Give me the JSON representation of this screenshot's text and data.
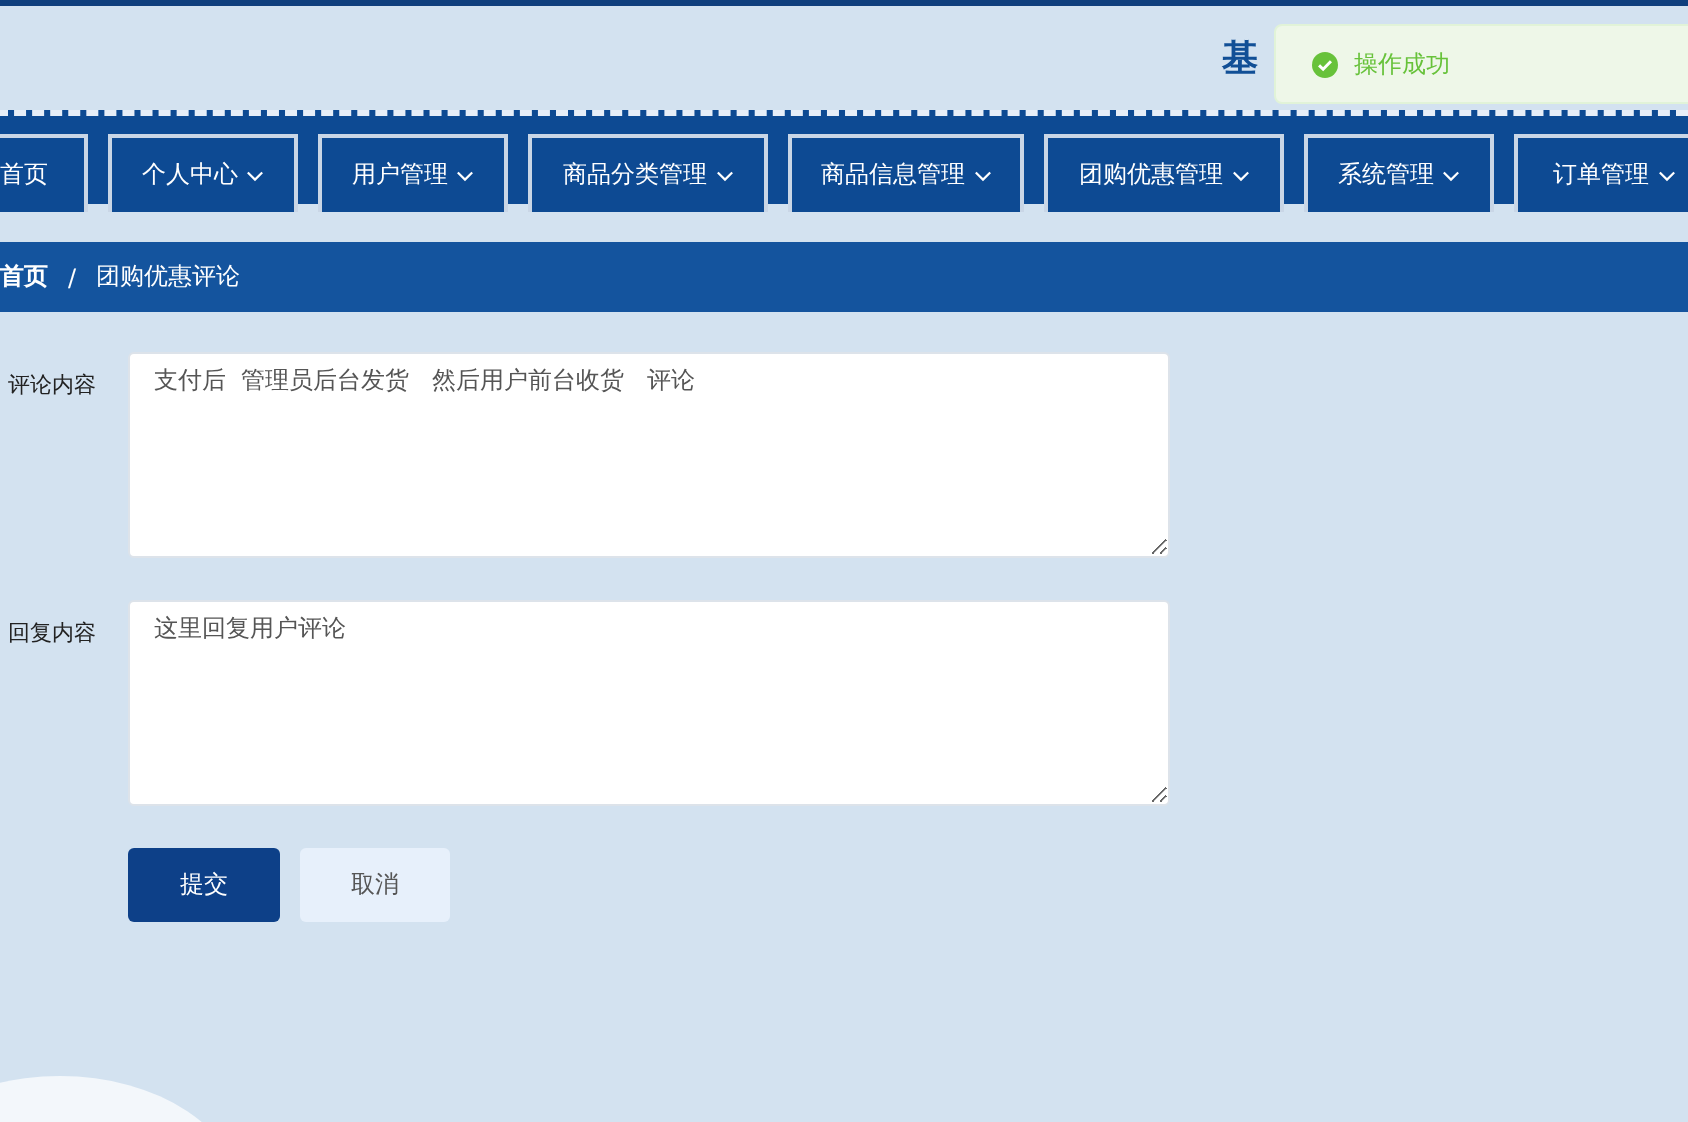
{
  "header": {
    "title": "基"
  },
  "toast": {
    "message": "操作成功"
  },
  "nav": [
    {
      "label": "首页",
      "has_menu": false
    },
    {
      "label": "个人中心",
      "has_menu": true
    },
    {
      "label": "用户管理",
      "has_menu": true
    },
    {
      "label": "商品分类管理",
      "has_menu": true
    },
    {
      "label": "商品信息管理",
      "has_menu": true
    },
    {
      "label": "团购优惠管理",
      "has_menu": true
    },
    {
      "label": "系统管理",
      "has_menu": true
    },
    {
      "label": "订单管理",
      "has_menu": true
    }
  ],
  "breadcrumb": {
    "separator": "/",
    "items": [
      "首页",
      "团购优惠评论"
    ]
  },
  "form": {
    "fields": [
      {
        "label": "评论内容",
        "value": "支付后  管理员后台发货   然后用户前台收货   评论"
      },
      {
        "label": "回复内容",
        "value": "这里回复用户评论"
      }
    ],
    "buttons": [
      {
        "label": "提交",
        "kind": "primary"
      },
      {
        "label": "取消",
        "kind": "secondary"
      }
    ]
  }
}
